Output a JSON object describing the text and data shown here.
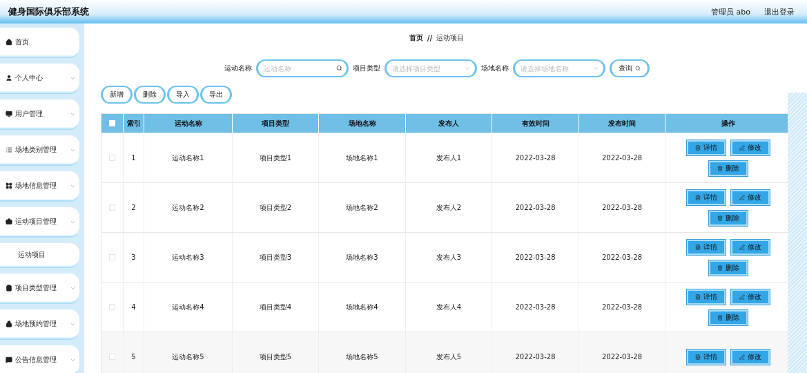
{
  "header": {
    "title": "健身国际俱乐部系统",
    "user": "管理员 abo",
    "logout": "退出登录"
  },
  "sidebar": {
    "items": [
      {
        "kind": "menu",
        "label": "首页",
        "expandable": false
      },
      {
        "kind": "menu",
        "label": "个人中心",
        "expandable": true
      },
      {
        "kind": "menu",
        "label": "用户管理",
        "expandable": true
      },
      {
        "kind": "menu",
        "label": "场地类别管理",
        "expandable": true
      },
      {
        "kind": "menu",
        "label": "场地信息管理",
        "expandable": true
      },
      {
        "kind": "menu",
        "label": "运动项目管理",
        "expandable": true
      },
      {
        "kind": "sub",
        "label": "运动项目",
        "expandable": false
      },
      {
        "kind": "menu",
        "label": "项目类型管理",
        "expandable": true
      },
      {
        "kind": "menu",
        "label": "场地预约管理",
        "expandable": true
      },
      {
        "kind": "menu",
        "label": "公告信息管理",
        "expandable": true
      }
    ]
  },
  "breadcrumb": [
    "首页",
    "//",
    "运动项目"
  ],
  "search": {
    "fields": [
      {
        "kind": "text",
        "label": "运动名称",
        "placeholder": "运动名称"
      },
      {
        "kind": "select",
        "label": "项目类型",
        "placeholder": "请选择项目类型"
      },
      {
        "kind": "select",
        "label": "场地名称",
        "placeholder": "请选择场地名称"
      }
    ],
    "button": "查询"
  },
  "actions": [
    "新增",
    "删除",
    "导入",
    "导出"
  ],
  "table": {
    "all_checked": false,
    "columns": [
      "索引",
      "运动名称",
      "项目类型",
      "场地名称",
      "发布人",
      "有效时间",
      "发布时间",
      "操作"
    ],
    "rows": [
      {
        "checked": false,
        "cells": [
          "1",
          "运动名称1",
          "项目类型1",
          "场地名称1",
          "发布人1",
          "2022-03-28",
          "2022-03-28"
        ],
        "buttons": [
          {
            "kind": "detail",
            "label": "详情"
          },
          {
            "kind": "edit",
            "label": "修改"
          },
          {
            "kind": "delete",
            "label": "删除"
          }
        ]
      },
      {
        "checked": false,
        "cells": [
          "2",
          "运动名称2",
          "项目类型2",
          "场地名称2",
          "发布人2",
          "2022-03-28",
          "2022-03-28"
        ],
        "buttons": [
          {
            "kind": "detail",
            "label": "详情"
          },
          {
            "kind": "edit",
            "label": "修改"
          },
          {
            "kind": "delete",
            "label": "删除"
          }
        ]
      },
      {
        "checked": false,
        "cells": [
          "3",
          "运动名称3",
          "项目类型3",
          "场地名称3",
          "发布人3",
          "2022-03-28",
          "2022-03-28"
        ],
        "buttons": [
          {
            "kind": "detail",
            "label": "详情"
          },
          {
            "kind": "edit",
            "label": "修改"
          },
          {
            "kind": "delete",
            "label": "删除"
          }
        ]
      },
      {
        "checked": false,
        "cells": [
          "4",
          "运动名称4",
          "项目类型4",
          "场地名称4",
          "发布人4",
          "2022-03-28",
          "2022-03-28"
        ],
        "buttons": [
          {
            "kind": "detail",
            "label": "详情"
          },
          {
            "kind": "edit",
            "label": "修改"
          },
          {
            "kind": "delete",
            "label": "删除"
          }
        ]
      },
      {
        "checked": false,
        "cells": [
          "5",
          "运动名称5",
          "项目类型5",
          "场地名称5",
          "发布人5",
          "2022-03-28",
          "2022-03-28"
        ],
        "buttons": [
          {
            "kind": "detail",
            "label": "详情"
          },
          {
            "kind": "edit",
            "label": "修改"
          }
        ]
      }
    ]
  }
}
